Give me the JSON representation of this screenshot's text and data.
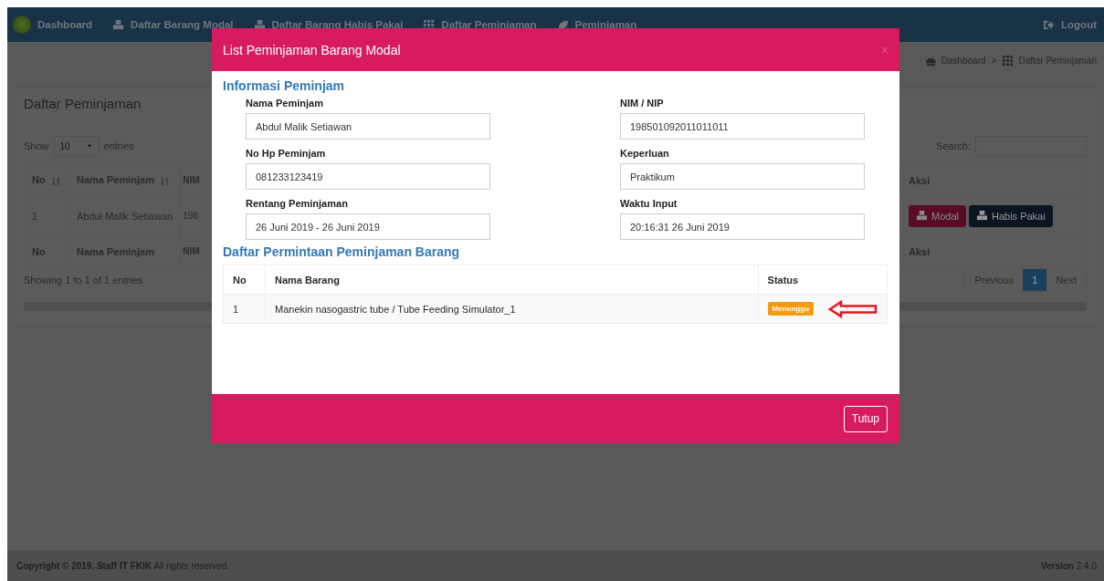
{
  "navbar": {
    "items": [
      {
        "label": "Dashboard"
      },
      {
        "label": "Daftar Barang Modal"
      },
      {
        "label": "Daftar Barang Habis Pakai"
      },
      {
        "label": "Daftar Peminjaman"
      },
      {
        "label": "Peminjaman"
      }
    ],
    "logout": "Logout"
  },
  "breadcrumb": [
    {
      "label": "Dashboard"
    },
    {
      "label": "Daftar Peminjaman"
    }
  ],
  "breadcrumb_separator": ">",
  "panel": {
    "title": "Daftar Peminjaman",
    "length": {
      "show": "Show",
      "value": "10",
      "entries": "entries"
    },
    "search_label": "Search:",
    "table": {
      "columns": [
        {
          "label": "No",
          "sortable": true
        },
        {
          "label": "Nama Peminjam",
          "sortable": true
        },
        {
          "label": "NIM",
          "sortable": false
        },
        {
          "label": "Aksi",
          "sortable": false
        }
      ],
      "rows": [
        {
          "cells": [
            "1",
            "Abdul Malik Setiawan",
            "198"
          ],
          "actions": [
            {
              "label": "Modal",
              "kind": "modal"
            },
            {
              "label": "Habis Pakai",
              "kind": "habis"
            }
          ]
        }
      ],
      "footer": [
        "No",
        "Nama Peminjam",
        "NIM",
        "Aksi"
      ]
    },
    "info": "Showing 1 to 1 of 1 entries",
    "pagination": [
      {
        "label": "Previous",
        "selected": false
      },
      {
        "label": "1",
        "selected": true
      },
      {
        "label": "Next",
        "selected": false
      }
    ]
  },
  "footer": {
    "copyright": "**Copyright © 2019. Staff IT FKIK** All rights reserved.",
    "version": "**Version** 2.4.0"
  },
  "modal": {
    "title": "List Peminjaman Barang Modal",
    "close": "×",
    "section_1": "Informasi Peminjam",
    "fields": [
      {
        "label": "Nama Peminjam",
        "value": "Abdul Malik Setiawan"
      },
      {
        "label": "NIM / NIP",
        "value": "198501092011011011"
      },
      {
        "label": "No Hp Peminjam",
        "value": "081233123419"
      },
      {
        "label": "Keperluan",
        "value": "Praktikum"
      },
      {
        "label": "Rentang Peminjaman",
        "value": "26 Juni 2019 - 26 Juni 2019"
      },
      {
        "label": "Waktu Input",
        "value": "20:16:31 26 Juni 2019"
      }
    ],
    "section_2": "Daftar Permintaan Peminjaman Barang",
    "table": {
      "columns": [
        "No",
        "Nama Barang",
        "Status"
      ],
      "rows": [
        {
          "no": "1",
          "name": "Manekin nasogastric tube / Tube Feeding Simulator_1",
          "status": "Menunggu",
          "arrow": true
        }
      ]
    },
    "button": "Tutup"
  }
}
